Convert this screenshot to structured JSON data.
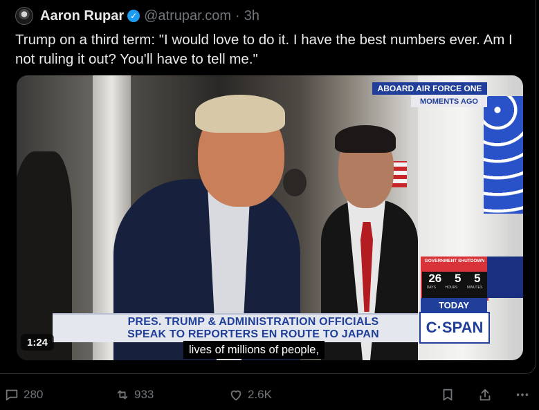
{
  "tweet": {
    "author_name": "Aaron Rupar",
    "handle": "@atrupar.com",
    "separator": "·",
    "time": "3h",
    "text": "Trump on a third term: \"I would love to do it. I have the best numbers ever. Am I not ruling it out? You'll have to tell me.\""
  },
  "video": {
    "duration": "1:24",
    "caption": "lives of millions of people,",
    "overlay": {
      "location_line1": "ABOARD AIR FORCE ONE",
      "location_line2": "MOMENTS AGO",
      "shutdown_title": "GOVERNMENT SHUTDOWN",
      "shutdown_days": "26",
      "shutdown_hours": "5",
      "shutdown_minutes": "5",
      "shutdown_labels": [
        "DAYS",
        "HOURS",
        "MINUTES"
      ],
      "today_label": "TODAY",
      "headline_line1": "PRES. TRUMP & ADMINISTRATION OFFICIALS",
      "headline_line2": "SPEAK TO REPORTERS EN ROUTE TO JAPAN",
      "network_logo": "C·SPAN"
    }
  },
  "actions": {
    "replies": "280",
    "reposts": "933",
    "likes": "2.6K"
  },
  "colors": {
    "background": "#000000",
    "text_primary": "#e7e9ea",
    "text_secondary": "#71767b",
    "verified_blue": "#1d9bf0",
    "cspan_blue": "#1f3f9a"
  },
  "icons": [
    "verified-badge-icon",
    "reply-icon",
    "repost-icon",
    "like-icon",
    "bookmark-icon",
    "share-icon",
    "more-icon"
  ]
}
